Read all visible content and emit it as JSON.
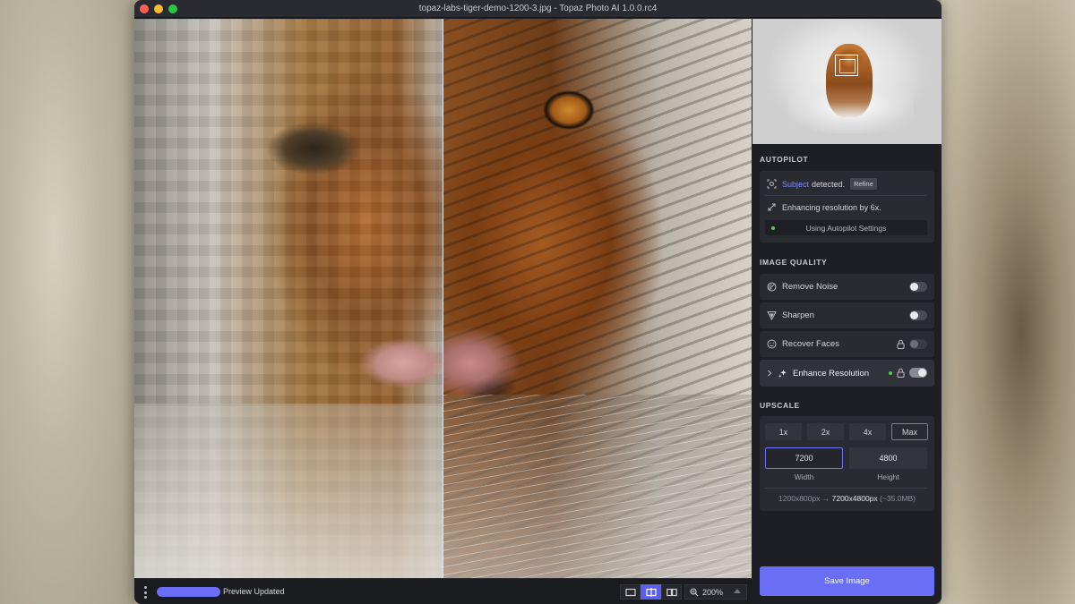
{
  "window": {
    "title": "topaz-labs-tiger-demo-1200-3.jpg - Topaz Photo AI 1.0.0.rc4"
  },
  "bottombar": {
    "status": "Preview Updated",
    "progress_fraction": 1.0,
    "zoom": "200%"
  },
  "autopilot": {
    "heading": "AUTOPILOT",
    "subject_word": "Subject",
    "detected_text": "detected.",
    "refine_label": "Refine",
    "enhancing_text": "Enhancing resolution by 6x.",
    "using_settings": "Using Autopilot Settings"
  },
  "image_quality": {
    "heading": "IMAGE QUALITY",
    "items": [
      {
        "label": "Remove Noise",
        "icon": "remove-noise-icon",
        "on": false,
        "locked": false
      },
      {
        "label": "Sharpen",
        "icon": "sharpen-icon",
        "on": false,
        "locked": false
      },
      {
        "label": "Recover Faces",
        "icon": "face-icon",
        "on": false,
        "locked": true
      },
      {
        "label": "Enhance Resolution",
        "icon": "sparkle-icon",
        "on": true,
        "locked": true
      }
    ]
  },
  "upscale": {
    "heading": "UPSCALE",
    "options": [
      "1x",
      "2x",
      "4x",
      "Max"
    ],
    "selected": "Max",
    "width_value": "7200",
    "height_value": "4800",
    "width_label": "Width",
    "height_label": "Height",
    "from_size": "1200x800px",
    "arrow": "→",
    "to_size": "7200x4800px",
    "file_size": "(~35.0MB)"
  },
  "save_label": "Save Image",
  "colors": {
    "accent": "#6a6ef5",
    "panel_bg": "#1e1f24",
    "card_bg": "#2a2b31",
    "status_green": "#47d14a"
  }
}
